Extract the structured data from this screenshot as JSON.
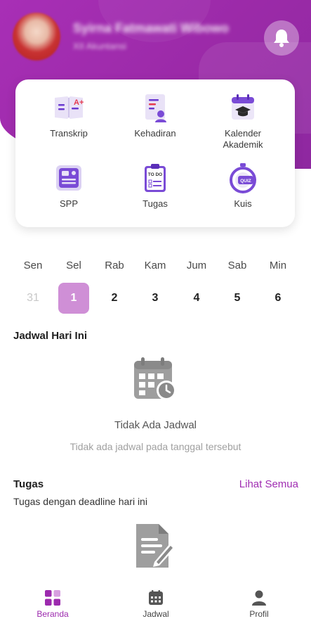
{
  "header": {
    "user_name": "Syirna Fatmawati Wibowo",
    "user_sub": "XII Akuntansi"
  },
  "menu": {
    "items": [
      {
        "label": "Transkrip",
        "icon": "transcript-icon"
      },
      {
        "label": "Kehadiran",
        "icon": "attendance-icon"
      },
      {
        "label": "Kalender\nAkademik",
        "icon": "academic-calendar-icon"
      },
      {
        "label": "SPP",
        "icon": "payment-icon"
      },
      {
        "label": "Tugas",
        "icon": "todo-clipboard-icon"
      },
      {
        "label": "Kuis",
        "icon": "quiz-stopwatch-icon"
      }
    ],
    "transcript_grade": "A+",
    "todo_text": "TO DO",
    "quiz_text": "QUIZ"
  },
  "calendar": {
    "days": [
      {
        "name": "Sen",
        "date": "31",
        "state": "muted"
      },
      {
        "name": "Sel",
        "date": "1",
        "state": "active"
      },
      {
        "name": "Rab",
        "date": "2",
        "state": "normal"
      },
      {
        "name": "Kam",
        "date": "3",
        "state": "normal"
      },
      {
        "name": "Jum",
        "date": "4",
        "state": "normal"
      },
      {
        "name": "Sab",
        "date": "5",
        "state": "normal"
      },
      {
        "name": "Min",
        "date": "6",
        "state": "normal"
      }
    ]
  },
  "schedule": {
    "title": "Jadwal Hari Ini",
    "empty_title": "Tidak Ada Jadwal",
    "empty_sub": "Tidak ada jadwal pada tanggal tersebut"
  },
  "tasks": {
    "title": "Tugas",
    "see_all": "Lihat Semua",
    "subtitle": "Tugas dengan deadline hari ini"
  },
  "nav": {
    "items": [
      {
        "label": "Beranda",
        "icon": "home-grid-icon",
        "active": true
      },
      {
        "label": "Jadwal",
        "icon": "calendar-icon",
        "active": false
      },
      {
        "label": "Profil",
        "icon": "user-icon",
        "active": false
      }
    ]
  },
  "colors": {
    "primary": "#9c2aae",
    "header_bg": "#a12fb3",
    "active_day": "#cf8fd6",
    "empty_icon": "#9e9e9e"
  }
}
